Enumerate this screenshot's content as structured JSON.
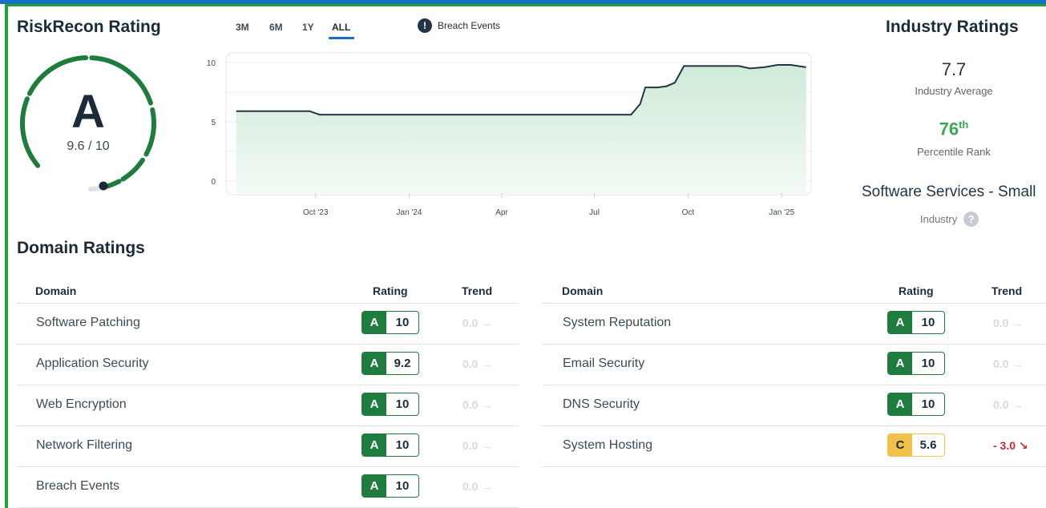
{
  "rating": {
    "title": "RiskRecon Rating",
    "grade": "A",
    "score": "9.6 / 10"
  },
  "range_tabs": [
    "3M",
    "6M",
    "1Y",
    "ALL"
  ],
  "selected_range": "ALL",
  "breach_legend": {
    "icon": "exclamation-icon",
    "label": "Breach Events"
  },
  "chart_data": {
    "type": "area",
    "x_ticks": [
      "Oct '23",
      "Jan '24",
      "Apr",
      "Jul",
      "Oct",
      "Jan '25"
    ],
    "y_ticks": [
      "0",
      "5",
      "10"
    ],
    "ylim": [
      0,
      10
    ],
    "grid": true,
    "series": [
      {
        "points": [
          [
            "2023-07-15",
            5.9
          ],
          [
            "2023-09-25",
            5.9
          ],
          [
            "2023-10-05",
            5.6
          ],
          [
            "2024-04-01",
            5.6
          ],
          [
            "2024-08-06",
            5.6
          ],
          [
            "2024-08-15",
            6.5
          ],
          [
            "2024-08-20",
            7.9
          ],
          [
            "2024-09-01",
            7.9
          ],
          [
            "2024-09-10",
            8.0
          ],
          [
            "2024-09-18",
            8.3
          ],
          [
            "2024-09-27",
            9.7
          ],
          [
            "2024-11-20",
            9.7
          ],
          [
            "2024-12-01",
            9.5
          ],
          [
            "2024-12-15",
            9.6
          ],
          [
            "2024-12-28",
            9.8
          ],
          [
            "2025-01-10",
            9.8
          ],
          [
            "2025-01-25",
            9.6
          ]
        ]
      }
    ]
  },
  "industry": {
    "title": "Industry Ratings",
    "average": "7.7",
    "average_label": "Industry Average",
    "rank_number": "76",
    "rank_suffix": "th",
    "rank_label": "Percentile Rank",
    "name": "Software Services - Small",
    "name_label": "Industry",
    "help_icon": "question-icon"
  },
  "domain_ratings": {
    "title": "Domain Ratings",
    "headers": {
      "domain": "Domain",
      "rating": "Rating",
      "trend": "Trend"
    },
    "left": [
      {
        "domain": "Software Patching",
        "grade": "A",
        "value": "10",
        "trend": "0.0 →"
      },
      {
        "domain": "Application Security",
        "grade": "A",
        "value": "9.2",
        "trend": "0.0 →"
      },
      {
        "domain": "Web Encryption",
        "grade": "A",
        "value": "10",
        "trend": "0.0 →"
      },
      {
        "domain": "Network Filtering",
        "grade": "A",
        "value": "10",
        "trend": "0.0 →"
      },
      {
        "domain": "Breach Events",
        "grade": "A",
        "value": "10",
        "trend": "0.0 →"
      }
    ],
    "right": [
      {
        "domain": "System Reputation",
        "grade": "A",
        "value": "10",
        "trend": "0.0 →"
      },
      {
        "domain": "Email Security",
        "grade": "A",
        "value": "10",
        "trend": "0.0 →"
      },
      {
        "domain": "DNS Security",
        "grade": "A",
        "value": "10",
        "trend": "0.0 →"
      },
      {
        "domain": "System Hosting",
        "grade": "C",
        "value": "5.6",
        "trend": "- 3.0 ↘"
      }
    ]
  },
  "colors": {
    "grade_a": "#1e7d3e",
    "grade_c": "#f0c247",
    "accent": "#1a6fc4",
    "trend_negative": "#c62834",
    "line": "#243447",
    "area": "#d8efe0"
  }
}
